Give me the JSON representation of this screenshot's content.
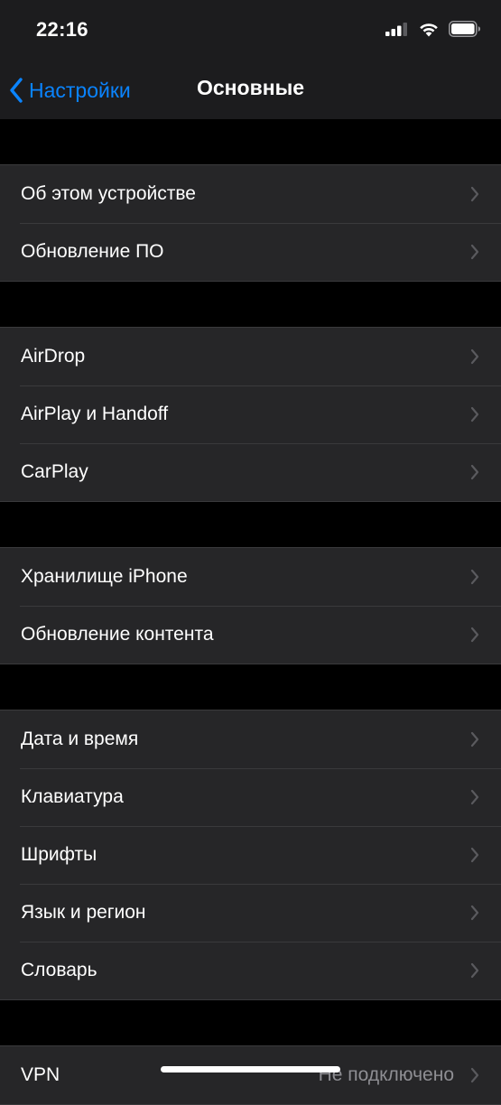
{
  "status_bar": {
    "time": "22:16"
  },
  "nav": {
    "back_label": "Настройки",
    "title": "Основные"
  },
  "groups": [
    {
      "rows": [
        {
          "label": "Об этом устройстве"
        },
        {
          "label": "Обновление ПО"
        }
      ]
    },
    {
      "rows": [
        {
          "label": "AirDrop"
        },
        {
          "label": "AirPlay и Handoff"
        },
        {
          "label": "CarPlay"
        }
      ]
    },
    {
      "rows": [
        {
          "label": "Хранилище iPhone"
        },
        {
          "label": "Обновление контента"
        }
      ]
    },
    {
      "rows": [
        {
          "label": "Дата и время"
        },
        {
          "label": "Клавиатура"
        },
        {
          "label": "Шрифты"
        },
        {
          "label": "Язык и регион"
        },
        {
          "label": "Словарь"
        }
      ]
    },
    {
      "rows": [
        {
          "label": "VPN",
          "value": "Не подключено"
        }
      ]
    }
  ],
  "colors": {
    "accent": "#0a84ff",
    "background": "#000000",
    "cell": "#262628",
    "separator": "#3a3a3c",
    "secondary_text": "#8e8e93"
  }
}
